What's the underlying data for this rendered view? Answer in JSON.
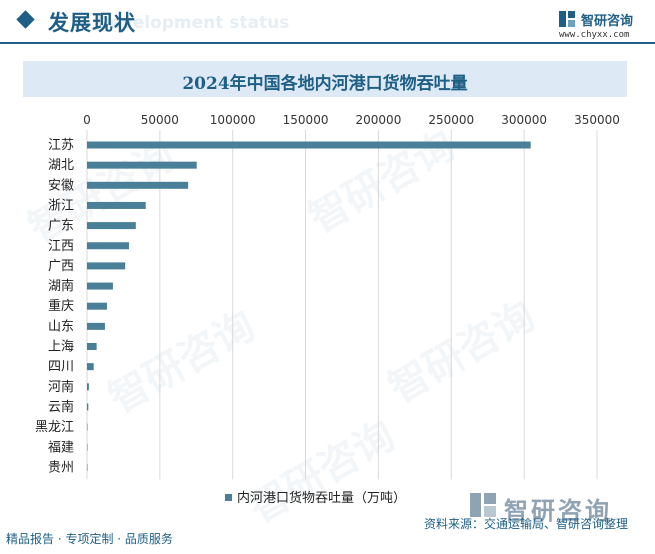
{
  "header": {
    "title": "发展现状",
    "subtitle": "Development status",
    "brand_name": "智研咨询",
    "brand_url": "www.chyxx.com"
  },
  "chart_data": {
    "type": "bar",
    "orientation": "horizontal",
    "title": "2024年中国各地内河港口货物吞吐量",
    "categories": [
      "江苏",
      "湖北",
      "安徽",
      "浙江",
      "广东",
      "江西",
      "广西",
      "湖南",
      "重庆",
      "山东",
      "上海",
      "四川",
      "河南",
      "云南",
      "黑龙江",
      "福建",
      "贵州"
    ],
    "series": [
      {
        "name": "内河港口货物吞吐量（万吨）",
        "values": [
          304500,
          75300,
          69400,
          40300,
          33500,
          28800,
          26200,
          17800,
          13700,
          12300,
          6600,
          4600,
          1300,
          900,
          200,
          100,
          100
        ],
        "color": "#4a7f98"
      }
    ],
    "xlim": [
      0,
      350000
    ],
    "xticks": [
      "0",
      "50000",
      "100000",
      "150000",
      "200000",
      "250000",
      "300000",
      "350000"
    ],
    "grid": true,
    "legend_position": "bottom"
  },
  "footer": {
    "left_text": "精品报告 · 专项定制 · 品质服务",
    "source_text": "资料来源：交通运输局、智研咨询整理",
    "logo_text": "智研咨询"
  },
  "watermark_text": "智研咨询",
  "colors": {
    "accent": "#1f5f86",
    "bar": "#4a7f98",
    "title_bg": "#ddeaf5",
    "grid": "#d9d9d9"
  }
}
